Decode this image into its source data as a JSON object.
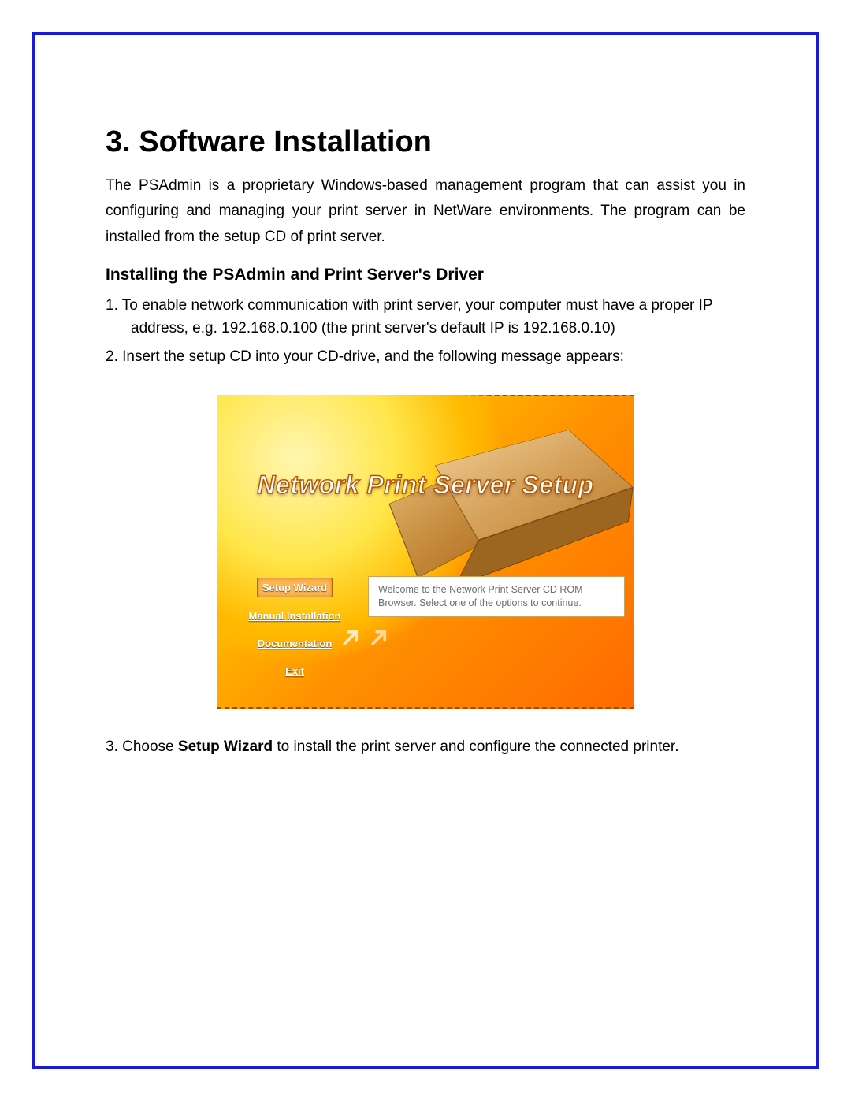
{
  "heading": "3. Software Installation",
  "intro": "The PSAdmin is a proprietary Windows-based management program that can assist you in configuring and managing your print server in NetWare environments. The program can be installed from the setup CD of print server.",
  "subheading": "Installing the PSAdmin and Print Server's Driver",
  "step1_line1": "1. To enable network communication with print server, your computer must have a proper IP",
  "step1_line2": "address, e.g. 192.168.0.100 (the print server's default IP is 192.168.0.10)",
  "step2": "2. Insert the setup CD into your CD-drive, and the following message appears:",
  "screenshot": {
    "title": "Network Print Server Setup",
    "menu": {
      "setup_wizard": "Setup Wizard",
      "manual_installation": "Manual Installation",
      "documentation": "Documentation",
      "exit": "Exit"
    },
    "welcome": "Welcome to the Network Print Server CD ROM Browser. Select one of the options to continue."
  },
  "step3_prefix": "3. Choose ",
  "step3_bold": "Setup Wizard",
  "step3_suffix": " to install the print server and configure the connected printer."
}
